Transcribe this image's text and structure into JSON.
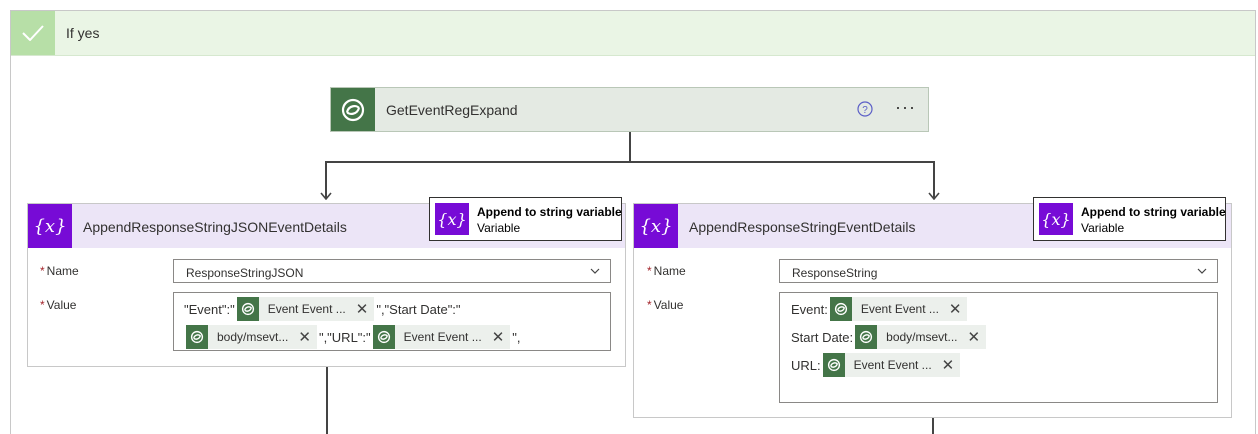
{
  "condition": {
    "label": "If yes"
  },
  "get_action": {
    "title": "GetEventRegExpand",
    "help": "?",
    "more": "···"
  },
  "left_card": {
    "title": "AppendResponseStringJSONEventDetails",
    "tooltip": {
      "title": "Append to string variable",
      "subtitle": "Variable"
    },
    "name_label": "Name",
    "name_value": "ResponseStringJSON",
    "value_label": "Value",
    "value_line1": {
      "prefix": "\"Event\":\"",
      "token1": "Event Event ...",
      "mid": "\",\"Start Date\":\""
    },
    "value_line2": {
      "token2": "body/msevt...",
      "mid": "\",\"URL\":\"",
      "token3": "Event Event ...",
      "suffix": "\","
    }
  },
  "right_card": {
    "title": "AppendResponseStringEventDetails",
    "tooltip": {
      "title": "Append to string variable",
      "subtitle": "Variable"
    },
    "name_label": "Name",
    "name_value": "ResponseString",
    "value_label": "Value",
    "line1": {
      "label": "Event:",
      "token": "Event Event ..."
    },
    "line2": {
      "label": "Start Date:",
      "token": "body/msevt..."
    },
    "line3": {
      "label": "URL:",
      "token": "Event Event ..."
    }
  },
  "colors": {
    "dataverse": "#447548",
    "variable": "#770bd6",
    "condition_bg": "#eaf5e5",
    "card_header": "#ece5f7"
  },
  "icons": {
    "check": "check-icon",
    "dataverse": "dataverse-icon",
    "variable": "variable-icon",
    "help": "help-icon",
    "chevron": "chevron-down-icon",
    "remove": "close-icon"
  }
}
